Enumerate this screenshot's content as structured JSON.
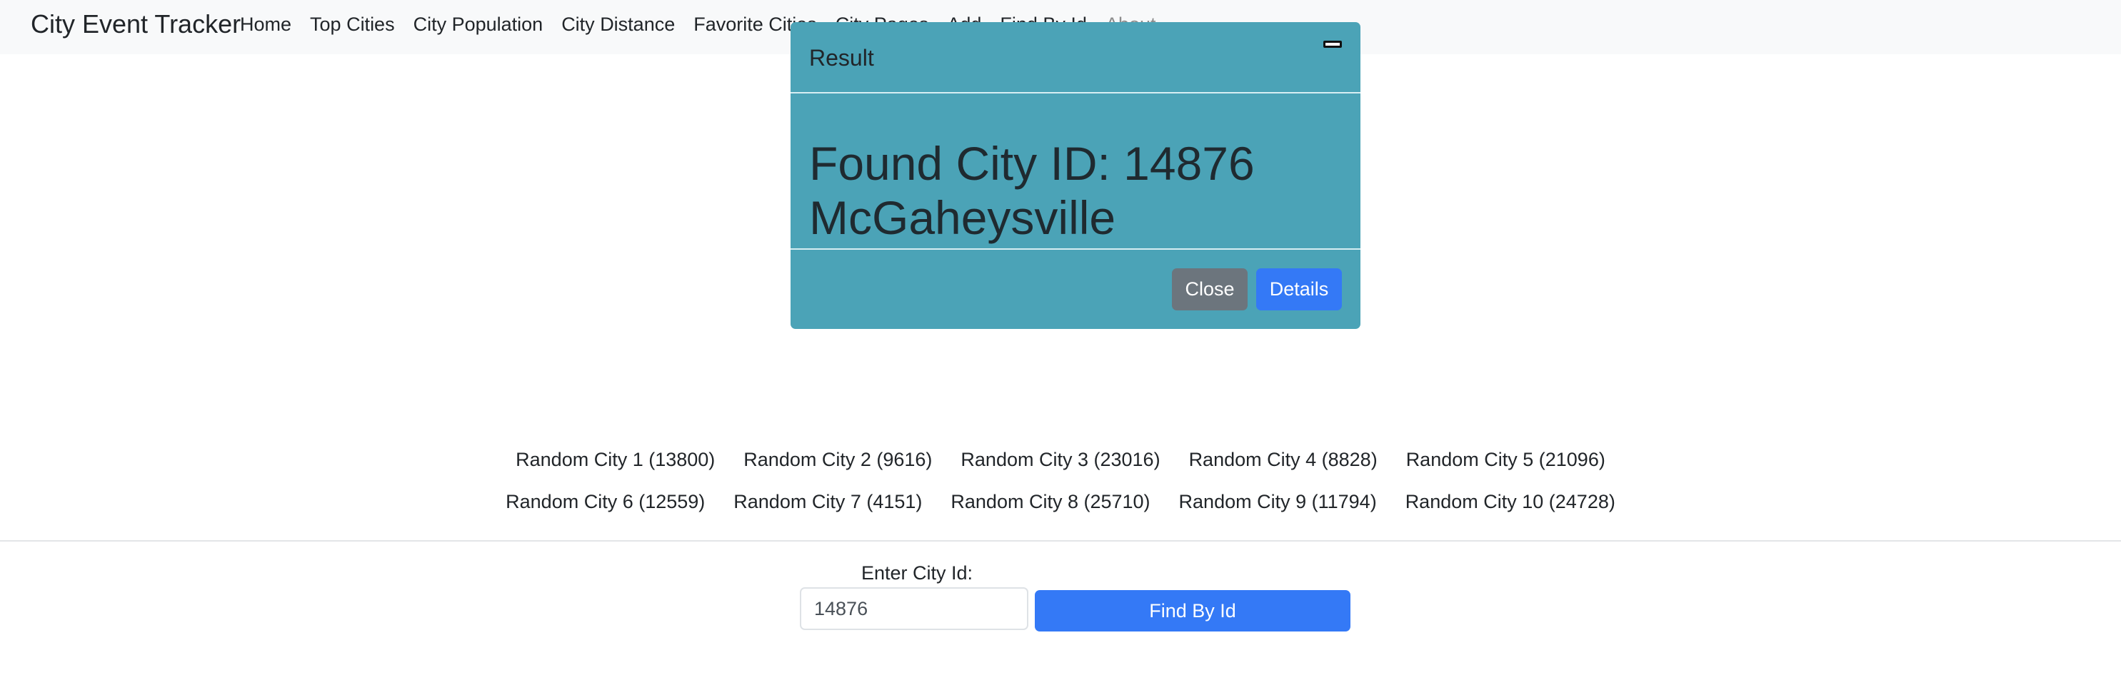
{
  "navbar": {
    "brand": "City Event Tracker",
    "links": [
      {
        "label": "Home"
      },
      {
        "label": "Top Cities"
      },
      {
        "label": "City Population"
      },
      {
        "label": "City Distance"
      },
      {
        "label": "Favorite Cities"
      },
      {
        "label": "City Pages"
      },
      {
        "label": "Add"
      },
      {
        "label": "Find By Id"
      },
      {
        "label": "About"
      }
    ]
  },
  "random_cities": {
    "row1": [
      "Random City 1 (13800)",
      "Random City 2 (9616)",
      "Random City 3 (23016)",
      "Random City 4 (8828)",
      "Random City 5 (21096)"
    ],
    "row2": [
      "Random City 6 (12559)",
      "Random City 7 (4151)",
      "Random City 8 (25710)",
      "Random City 9 (11794)",
      "Random City 10 (24728)"
    ]
  },
  "find_form": {
    "label": "Enter City Id:",
    "input_value": "14876",
    "button_label": "Find By Id"
  },
  "modal": {
    "title": "Result",
    "message": "Found City ID: 14876 McGaheysville",
    "close_label": "Close",
    "details_label": "Details"
  },
  "colors": {
    "navbar_bg": "#f8f9fa",
    "modal_bg": "#4ba3b7",
    "primary": "#3479f6",
    "secondary": "#6c757d"
  }
}
